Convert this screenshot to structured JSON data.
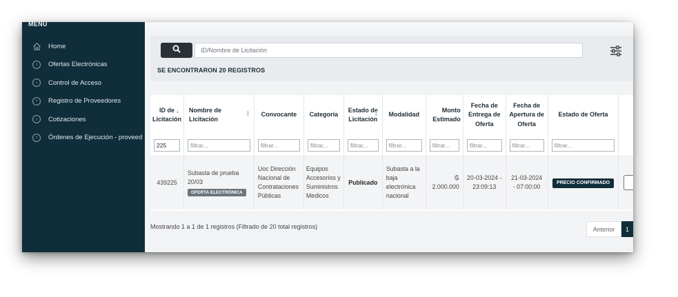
{
  "sidebar": {
    "title": "MENU",
    "items": [
      {
        "label": "Home",
        "icon": "home-icon"
      },
      {
        "label": "Ofertas Electrónicas",
        "icon": "chevron-circle-icon"
      },
      {
        "label": "Control de Acceso",
        "icon": "chevron-circle-icon"
      },
      {
        "label": "Registro de Proveedores",
        "icon": "chevron-circle-icon"
      },
      {
        "label": "Cotizaciones",
        "icon": "chevron-circle-icon"
      },
      {
        "label": "Órdenes de Ejecución - proveed",
        "icon": "chevron-circle-icon"
      }
    ]
  },
  "search": {
    "placeholder": "ID/Nombre de Licitación",
    "records_label": "SE ENCONTRARON 20 REGISTROS"
  },
  "table": {
    "headers": {
      "id": "ID de Licitación",
      "nombre": "Nombre de Licitación",
      "convocante": "Convocante",
      "categoria": "Categoría",
      "estado": "Estado de Licitación",
      "modalidad": "Modalidad",
      "monto": "Monto Estimado",
      "entrega": "Fecha de Entrega de Oferta",
      "apertura": "Fecha de Apertura de Oferta",
      "estado_oferta": "Estado de Oferta"
    },
    "filters": {
      "id_value": "225",
      "placeholder": "filtrar..."
    },
    "row": {
      "id": "439225",
      "nombre": "Subasta de prueba 20/03",
      "nombre_badge": "OFERTA ELECTRÓNICA",
      "convocante": "Uoc Dirección Nacional de Contrataciones Públicas",
      "categoria": "Equipos Accesorios y Suministros Medicos",
      "estado": "Publicado",
      "modalidad": "Subasta a la baja electrónica nacional",
      "monto_symbol": "₲",
      "monto": "2.000.000",
      "entrega": "20-03-2024 - 23:09:13",
      "apertura": "21-03-2024 - 07:00:00",
      "estado_oferta": "PRECIO CONFIRMADO"
    }
  },
  "footer": {
    "info": "Mostrando 1 a 1 de 1 registros (Filtrado de 20 total registros)",
    "prev_label": "Anterior",
    "page": "1"
  },
  "colors": {
    "sidebar_bg": "#0f2d3a",
    "accent": "#0f2d3a",
    "search_btn": "#2b3237"
  }
}
